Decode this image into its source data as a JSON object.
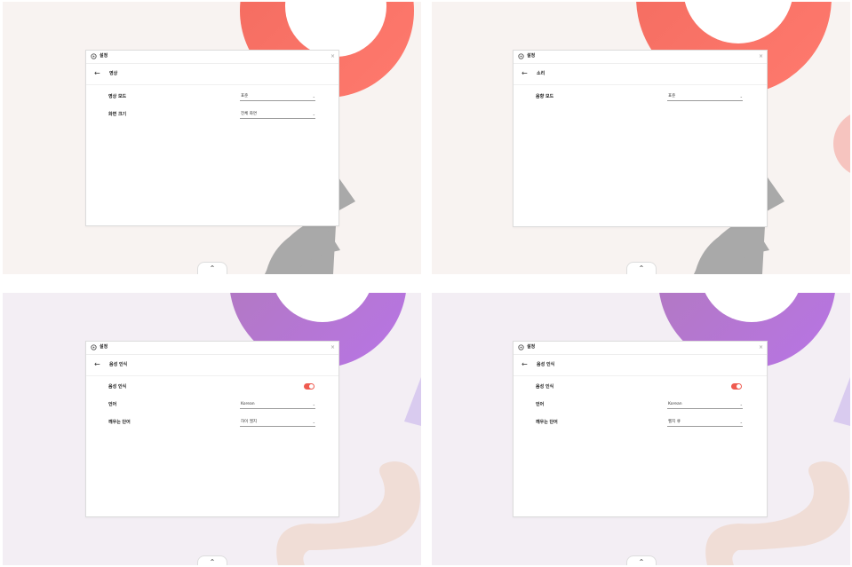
{
  "panels": [
    {
      "window": {
        "title": "설정",
        "close_label": "×"
      },
      "header": {
        "back_label": "←",
        "title": "영상"
      },
      "rows": [
        {
          "label": "영상 모드",
          "kind": "select",
          "value": "표준",
          "arrow": "⌄"
        },
        {
          "label": "화면 크기",
          "kind": "select",
          "value": "전체 화면",
          "arrow": "⌄"
        }
      ],
      "bottom_tab": {
        "label": "⌃"
      }
    },
    {
      "window": {
        "title": "설정",
        "close_label": "×"
      },
      "header": {
        "back_label": "←",
        "title": "소리"
      },
      "rows": [
        {
          "label": "음향 모드",
          "kind": "select",
          "value": "표준",
          "arrow": "⌄"
        }
      ],
      "bottom_tab": {
        "label": "⌃"
      }
    },
    {
      "window": {
        "title": "설정",
        "close_label": "×"
      },
      "header": {
        "back_label": "←",
        "title": "음성 인식"
      },
      "rows": [
        {
          "label": "음성 인식",
          "kind": "toggle",
          "on": true
        },
        {
          "label": "언어",
          "kind": "select",
          "value": "Korean",
          "arrow": "⌄"
        },
        {
          "label": "깨우는 단어",
          "kind": "select",
          "value": "하이 엘지",
          "arrow": "⌄"
        }
      ],
      "bottom_tab": {
        "label": "⌃"
      }
    },
    {
      "window": {
        "title": "설정",
        "close_label": "×"
      },
      "header": {
        "back_label": "←",
        "title": "음성 인식"
      },
      "rows": [
        {
          "label": "음성 인식",
          "kind": "toggle",
          "on": true
        },
        {
          "label": "언어",
          "kind": "select",
          "value": "Korean",
          "arrow": "⌄"
        },
        {
          "label": "깨우는 단어",
          "kind": "select",
          "value": "헬지 큐",
          "arrow": "⌄"
        }
      ],
      "bottom_tab": {
        "label": "⌃"
      }
    }
  ],
  "colors": {
    "warm_bg": "#f8f3f1",
    "cool_bg": "#f3eef4",
    "coral": "#f4695d",
    "gray_stripe": "#a9a9a9",
    "pink_circle": "#f6c4bf",
    "purple": "#b47fc9",
    "lavender": "#d9cbef",
    "peach": "#f0ddd6",
    "toggle_on": "#ef5b50"
  }
}
